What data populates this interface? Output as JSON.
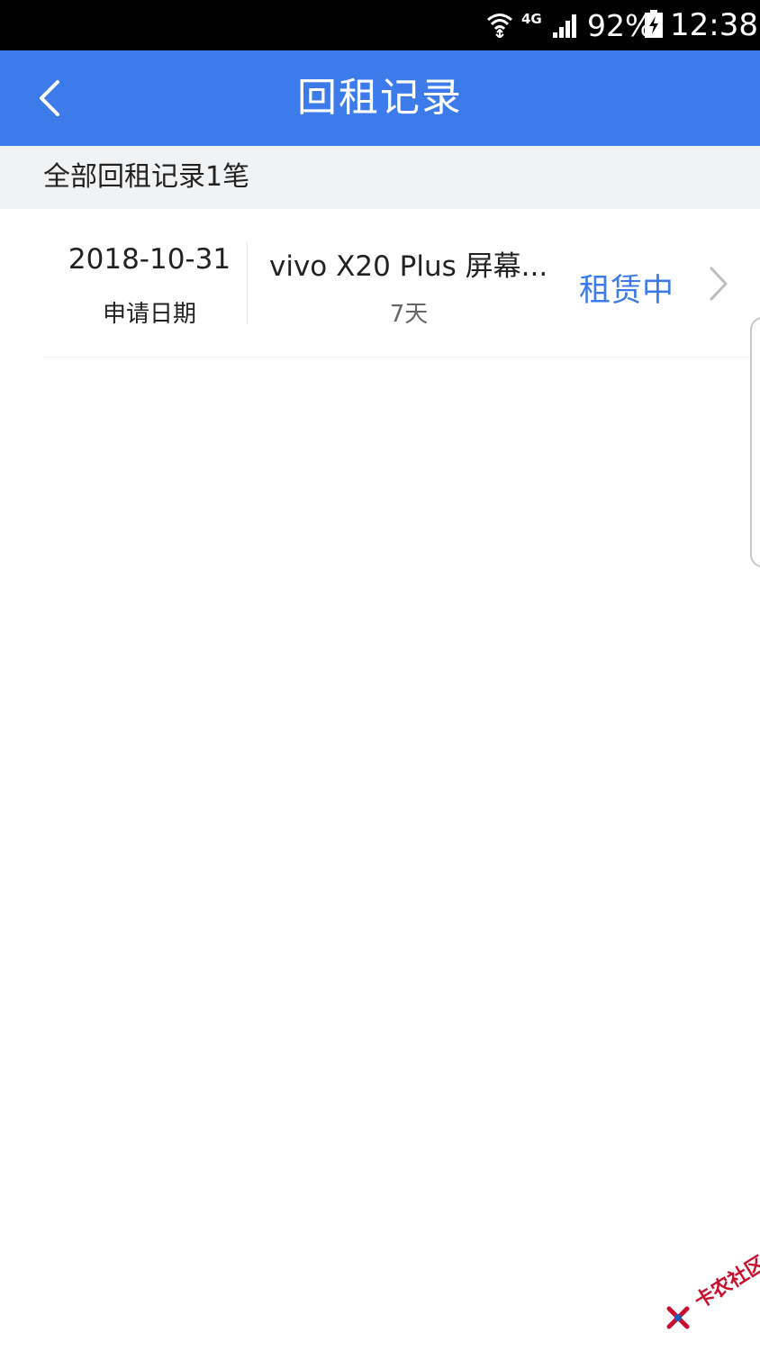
{
  "status_bar": {
    "network": "4G",
    "battery_percent": "92%",
    "time": "12:38"
  },
  "header": {
    "title": "回租记录"
  },
  "summary": {
    "text": "全部回租记录1笔"
  },
  "records": [
    {
      "date": "2018-10-31",
      "date_label": "申请日期",
      "product": "vivo X20 Plus 屏幕...",
      "duration": "7天",
      "status": "租赁中"
    }
  ],
  "watermark": {
    "text": "卡农社区"
  },
  "colors": {
    "primary": "#3d7bea",
    "status_bar": "#000000",
    "summary_bg": "#f1f2f4"
  }
}
